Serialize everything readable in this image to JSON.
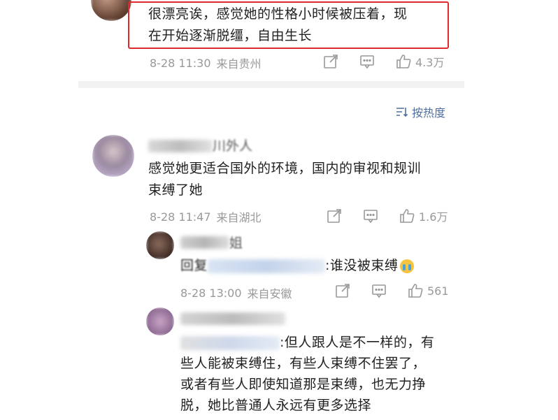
{
  "comment1": {
    "text_line1": "很漂亮诶，感觉她的性格小时候被压着，现",
    "text_line2": "在开始逐渐脱缰，自由生长",
    "time": "8-28 11:30",
    "location": "来自贵州",
    "likes": "4.3万"
  },
  "sort": {
    "label": "按热度"
  },
  "comment2": {
    "name_tail": "川外人",
    "text_line1": "感觉她更适合国外的环境，国内的审视和规训",
    "text_line2": "束缚了她",
    "time": "8-28 11:47",
    "location": "来自湖北",
    "likes": "1.6万"
  },
  "reply1": {
    "name_tail": "姐",
    "prefix": "回复",
    "text": ":谁没被束缚",
    "emoji": "loudly-crying-face",
    "time": "8-28 13:00",
    "location": "来自安徽",
    "likes": "561"
  },
  "reply2": {
    "text_line1": ":但人跟人是不一样的，有",
    "text_line2": "些人能被束缚住，有些人束缚不住罢了，",
    "text_line3": "或者有些人即使知道那是束缚，也无力挣",
    "text_line4": "脱，她比普通人永远有更多选择"
  },
  "colors": {
    "highlight": "#e0282e",
    "link": "#4f6fa0",
    "meta": "#999999"
  }
}
